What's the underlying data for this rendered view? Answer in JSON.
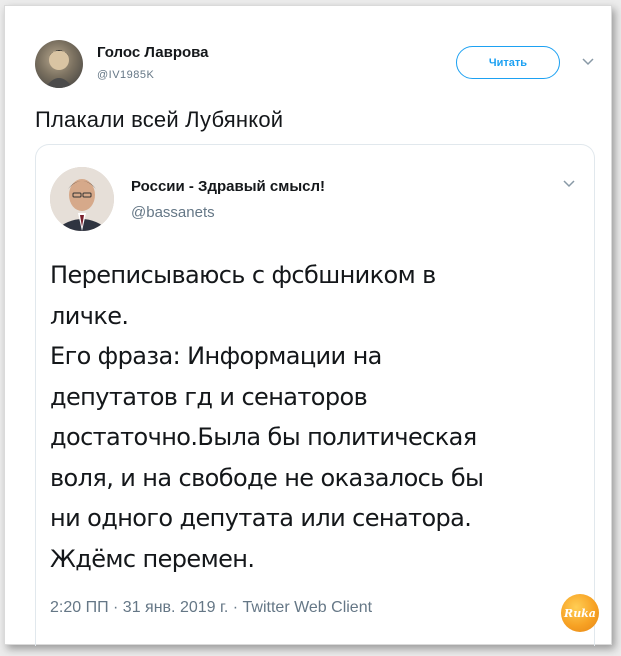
{
  "tweet": {
    "author": {
      "name": "Голос Лаврова",
      "handle": "@IV1985K"
    },
    "follow_label": "Читать",
    "text": "Плакали всей Лубянкой"
  },
  "quoted": {
    "author": {
      "name": "России - Здравый смысл!",
      "handle": "@bassanets"
    },
    "lines": [
      "Переписываюсь с фсбшником в",
      "личке.",
      "Его фраза: Информации на",
      "депутатов гд и сенаторов",
      "достаточно.Была бы политическая",
      "воля, и на свободе не оказалось бы",
      "ни одного депутата или сенатора.",
      "Ждёмс перемен."
    ],
    "meta": "2:20 ПП · 31 янв. 2019 г. · Twitter Web Client"
  },
  "watermark": {
    "label": "Ruka",
    "color": "#f7a224"
  },
  "colors": {
    "accent": "#1da1f2",
    "text": "#14171a",
    "muted": "#657786"
  }
}
